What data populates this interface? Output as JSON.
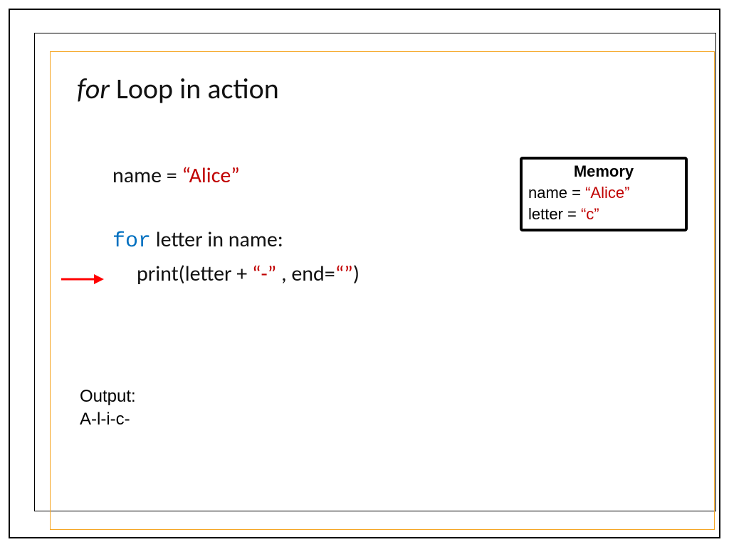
{
  "title": {
    "for_word": "for",
    "rest": " Loop in action"
  },
  "code": {
    "line1_pre": "name = ",
    "line1_val": "“Alice”",
    "line2_kw": "for",
    "line2_rest": " letter in name:",
    "line3_pre": "print(letter + ",
    "line3_str1": "“-”",
    "line3_mid": " , end=",
    "line3_str2": "“”",
    "line3_post": ")"
  },
  "memory": {
    "title": "Memory",
    "line1_pre": "name = ",
    "line1_val": "“Alice”",
    "line2_pre": "letter = ",
    "line2_val": "“c”"
  },
  "output": {
    "label": "Output:",
    "text": "A-l-i-c-"
  },
  "colors": {
    "red": "#c00000",
    "blue": "#0070c0",
    "orange": "#f5a623"
  }
}
